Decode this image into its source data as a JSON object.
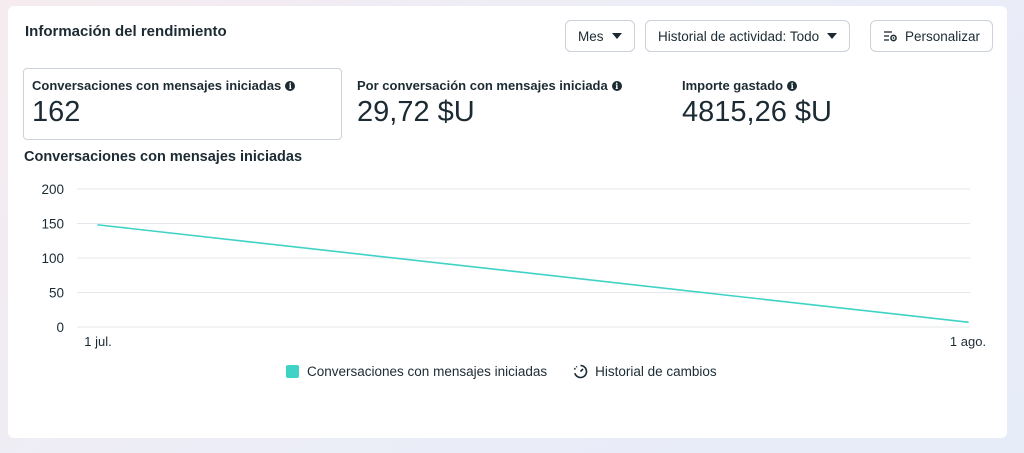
{
  "header": {
    "title": "Información del rendimiento",
    "period_label": "Mes",
    "activity_label": "Historial de actividad: Todo",
    "customize_label": "Personalizar"
  },
  "metrics": [
    {
      "label": "Conversaciones con mensajes iniciadas",
      "value": "162"
    },
    {
      "label": "Por conversación con mensajes iniciada",
      "value": "29,72 $U"
    },
    {
      "label": "Importe gastado",
      "value": "4815,26 $U"
    }
  ],
  "colors": {
    "series": "#3fd3c6",
    "grid": "#e4e7eb",
    "text": "#1c2b33"
  },
  "icons": {
    "info": "info-icon",
    "customize": "sliders-gear-icon",
    "history": "history-icon"
  },
  "legend": {
    "series_label": "Conversaciones con mensajes iniciadas",
    "history_label": "Historial de cambios"
  },
  "chart_data": {
    "type": "line",
    "title": "Conversaciones con mensajes iniciadas",
    "xlabel": "",
    "ylabel": "",
    "x": [
      "1 jul.",
      "1 ago."
    ],
    "yticks": [
      0,
      50,
      100,
      150,
      200
    ],
    "ylim": [
      0,
      200
    ],
    "grid": true,
    "legend_position": "bottom",
    "series": [
      {
        "name": "Conversaciones con mensajes iniciadas",
        "values": [
          148,
          7
        ]
      }
    ]
  }
}
